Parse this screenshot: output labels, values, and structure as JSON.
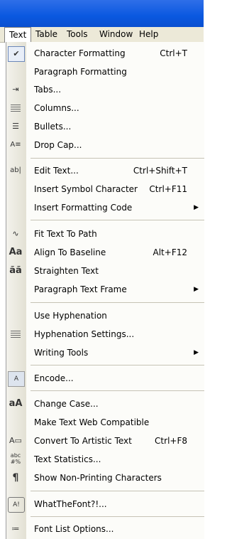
{
  "menubar": [
    {
      "label": "Text",
      "active": true
    },
    {
      "label": "Table"
    },
    {
      "label": "Tools"
    },
    {
      "label": "Window"
    },
    {
      "label": "Help"
    }
  ],
  "menu": {
    "items": [
      {
        "label": "Character Formatting",
        "shortcut": "Ctrl+T",
        "icon": "checkmark-icon"
      },
      {
        "label": "Paragraph Formatting"
      },
      {
        "label": "Tabs...",
        "icon": "tabs-icon"
      },
      {
        "label": "Columns...",
        "icon": "columns-icon"
      },
      {
        "label": "Bullets...",
        "icon": "bullets-icon"
      },
      {
        "label": "Drop Cap...",
        "icon": "drop-cap-icon"
      },
      {
        "label": "Edit Text...",
        "shortcut": "Ctrl+Shift+T",
        "icon": "edit-text-icon"
      },
      {
        "label": "Insert Symbol Character",
        "shortcut": "Ctrl+F11"
      },
      {
        "label": "Insert Formatting Code",
        "submenu": true
      },
      {
        "label": "Fit Text To Path",
        "icon": "fit-text-to-path-icon"
      },
      {
        "label": "Align To Baseline",
        "shortcut": "Alt+F12",
        "icon": "align-to-baseline-icon"
      },
      {
        "label": "Straighten Text",
        "icon": "straighten-text-icon"
      },
      {
        "label": "Paragraph Text Frame",
        "submenu": true
      },
      {
        "label": "Use Hyphenation"
      },
      {
        "label": "Hyphenation Settings...",
        "icon": "hyphenation-icon"
      },
      {
        "label": "Writing Tools",
        "submenu": true
      },
      {
        "label": "Encode...",
        "icon": "encode-icon"
      },
      {
        "label": "Change Case...",
        "icon": "change-case-icon"
      },
      {
        "label": "Make Text Web Compatible"
      },
      {
        "label": "Convert To Artistic Text",
        "shortcut": "Ctrl+F8",
        "icon": "convert-artistic-icon"
      },
      {
        "label": "Text Statistics...",
        "icon": "text-statistics-icon"
      },
      {
        "label": "Show Non-Printing Characters",
        "icon": "pilcrow-icon"
      },
      {
        "label": "WhatTheFont?!...",
        "icon": "whatthefont-icon"
      },
      {
        "label": "Font List Options...",
        "icon": "font-list-icon"
      }
    ]
  }
}
